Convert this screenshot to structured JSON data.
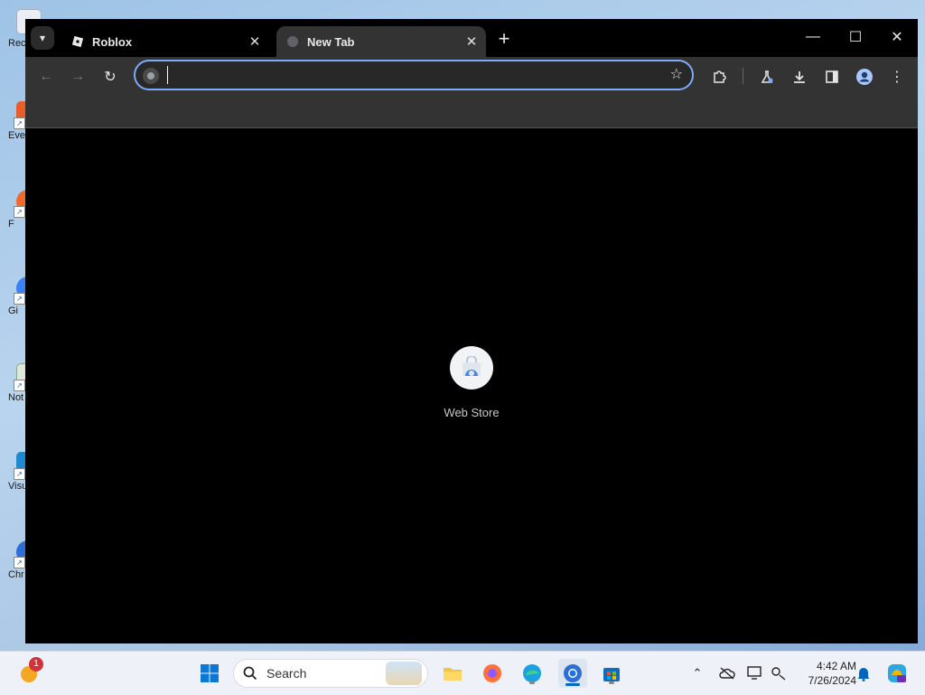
{
  "desktop": {
    "icons": [
      {
        "label": "Rec"
      },
      {
        "label": "Eve"
      },
      {
        "label": "F"
      },
      {
        "label": "Gi"
      },
      {
        "label": "Not"
      },
      {
        "label": "Visu"
      },
      {
        "label": "Chr"
      }
    ]
  },
  "browser": {
    "tabs": [
      {
        "title": "Roblox",
        "active": false
      },
      {
        "title": "New Tab",
        "active": true
      }
    ],
    "tab_close_glyph": "✕",
    "new_tab_glyph": "+",
    "window_controls": {
      "minimize": "—",
      "maximize": "☐",
      "close": "✕"
    },
    "omnibox": {
      "value": "",
      "placeholder": ""
    },
    "shortcuts": [
      {
        "name": "Web Store"
      }
    ]
  },
  "taskbar": {
    "search_label": "Search",
    "notification_badge": "1",
    "time": "4:42 AM",
    "date": "7/26/2024"
  },
  "colors": {
    "accent": "#7cacf8",
    "toolbar": "#333333",
    "taskbar_active": "#0067c0"
  }
}
